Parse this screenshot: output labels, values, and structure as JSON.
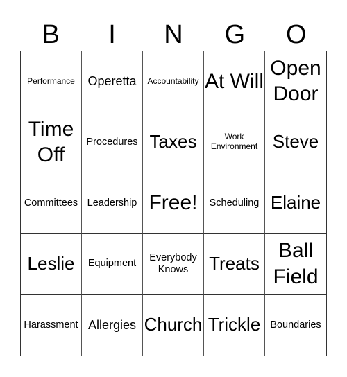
{
  "header": {
    "letters": [
      "B",
      "I",
      "N",
      "G",
      "O"
    ]
  },
  "card": {
    "rows": [
      [
        {
          "text": "Performance",
          "size": "xs"
        },
        {
          "text": "Operetta",
          "size": "m"
        },
        {
          "text": "Accountability",
          "size": "xs"
        },
        {
          "text": "At Will",
          "size": "xl"
        },
        {
          "text": "Open Door",
          "size": "xl"
        }
      ],
      [
        {
          "text": "Time Off",
          "size": "xl"
        },
        {
          "text": "Procedures",
          "size": "s"
        },
        {
          "text": "Taxes",
          "size": "l"
        },
        {
          "text": "Work Environment",
          "size": "xs"
        },
        {
          "text": "Steve",
          "size": "l"
        }
      ],
      [
        {
          "text": "Committees",
          "size": "s"
        },
        {
          "text": "Leadership",
          "size": "s"
        },
        {
          "text": "Free!",
          "size": "xl"
        },
        {
          "text": "Scheduling",
          "size": "s"
        },
        {
          "text": "Elaine",
          "size": "l"
        }
      ],
      [
        {
          "text": "Leslie",
          "size": "l"
        },
        {
          "text": "Equipment",
          "size": "s"
        },
        {
          "text": "Everybody Knows",
          "size": "s"
        },
        {
          "text": "Treats",
          "size": "l"
        },
        {
          "text": "Ball Field",
          "size": "xl"
        }
      ],
      [
        {
          "text": "Harassment",
          "size": "s"
        },
        {
          "text": "Allergies",
          "size": "m"
        },
        {
          "text": "Church",
          "size": "l"
        },
        {
          "text": "Trickle",
          "size": "l"
        },
        {
          "text": "Boundaries",
          "size": "s"
        }
      ]
    ]
  }
}
